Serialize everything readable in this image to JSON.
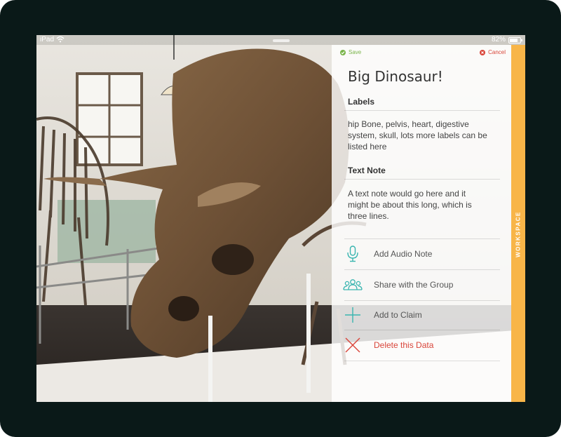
{
  "status_bar": {
    "device": "iPad",
    "battery": "82%",
    "battery_level": 0.82
  },
  "panel": {
    "save_label": "Save",
    "cancel_label": "Cancel",
    "title": "Big Dinosaur!",
    "labels_heading": "Labels",
    "labels_text": "hip Bone, pelvis, heart, digestive system, skull, lots more labels can be listed here",
    "note_heading": "Text Note",
    "note_text": "A text note would go here and it might be about this long, which is three lines.",
    "actions": [
      {
        "label": "Add Audio Note",
        "icon": "microphone-icon"
      },
      {
        "label": "Share with the Group",
        "icon": "group-icon"
      },
      {
        "label": "Add to Claim",
        "icon": "plus-icon"
      },
      {
        "label": "Delete this Data",
        "icon": "close-icon"
      }
    ],
    "workspace_label": "WORKSPACE"
  },
  "colors": {
    "accent_teal": "#3ab5b0",
    "danger": "#d9453a",
    "success": "#7ab44a",
    "workspace": "#f8b548"
  }
}
